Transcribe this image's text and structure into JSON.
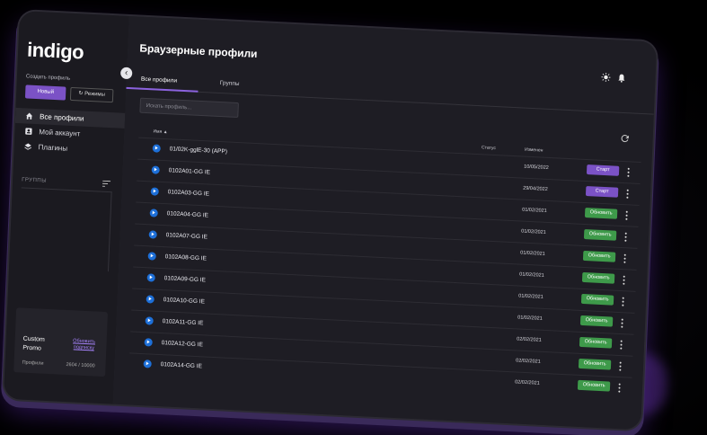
{
  "app": {
    "logo": "indigo"
  },
  "sidebar": {
    "create_label": "Создать профиль",
    "new_button": "Новый",
    "sync_button": "↻ Режимы",
    "items": [
      {
        "label": "Все профили",
        "icon": "home-icon"
      },
      {
        "label": "Мой аккаунт",
        "icon": "account-icon"
      },
      {
        "label": "Плагины",
        "icon": "layers-icon"
      }
    ],
    "groups_label": "ГРУППЫ",
    "promo": {
      "title": "Custom Promo",
      "link": "Обновить подписку",
      "profiles_label": "Профили",
      "profiles_count": "2604 / 10000"
    }
  },
  "header": {
    "title": "Браузерные профили",
    "tabs": [
      {
        "label": "Все профили"
      },
      {
        "label": "Группы"
      }
    ]
  },
  "search": {
    "placeholder": "Искать профиль..."
  },
  "table": {
    "columns": {
      "name": "Имя ▲",
      "status": "Статус",
      "modified": "Изменен"
    },
    "rows": [
      {
        "name": "01/02K-gglE-30 (APP)",
        "date": "10/05/2022",
        "action": "Старт"
      },
      {
        "name": "0102A01-GG IE",
        "date": "29/04/2022",
        "action": "Старт"
      },
      {
        "name": "0102A03-GG IE",
        "date": "01/02/2021",
        "action": "Обновить"
      },
      {
        "name": "0102A04-GG IE",
        "date": "01/02/2021",
        "action": "Обновить"
      },
      {
        "name": "0102A07-GG IE",
        "date": "01/02/2021",
        "action": "Обновить"
      },
      {
        "name": "0102A08-GG IE",
        "date": "01/02/2021",
        "action": "Обновить"
      },
      {
        "name": "0102A09-GG IE",
        "date": "01/02/2021",
        "action": "Обновить"
      },
      {
        "name": "0102A10-GG IE",
        "date": "01/02/2021",
        "action": "Обновить"
      },
      {
        "name": "0102A11-GG IE",
        "date": "02/02/2021",
        "action": "Обновить"
      },
      {
        "name": "0102A12-GG IE",
        "date": "02/02/2021",
        "action": "Обновить"
      },
      {
        "name": "0102A14-GG IE",
        "date": "02/02/2021",
        "action": "Обновить"
      }
    ]
  },
  "colors": {
    "accent": "#7b52c6",
    "update": "#3e9a4a",
    "play": "#1d6fd8",
    "bg": "#1e1d24"
  }
}
